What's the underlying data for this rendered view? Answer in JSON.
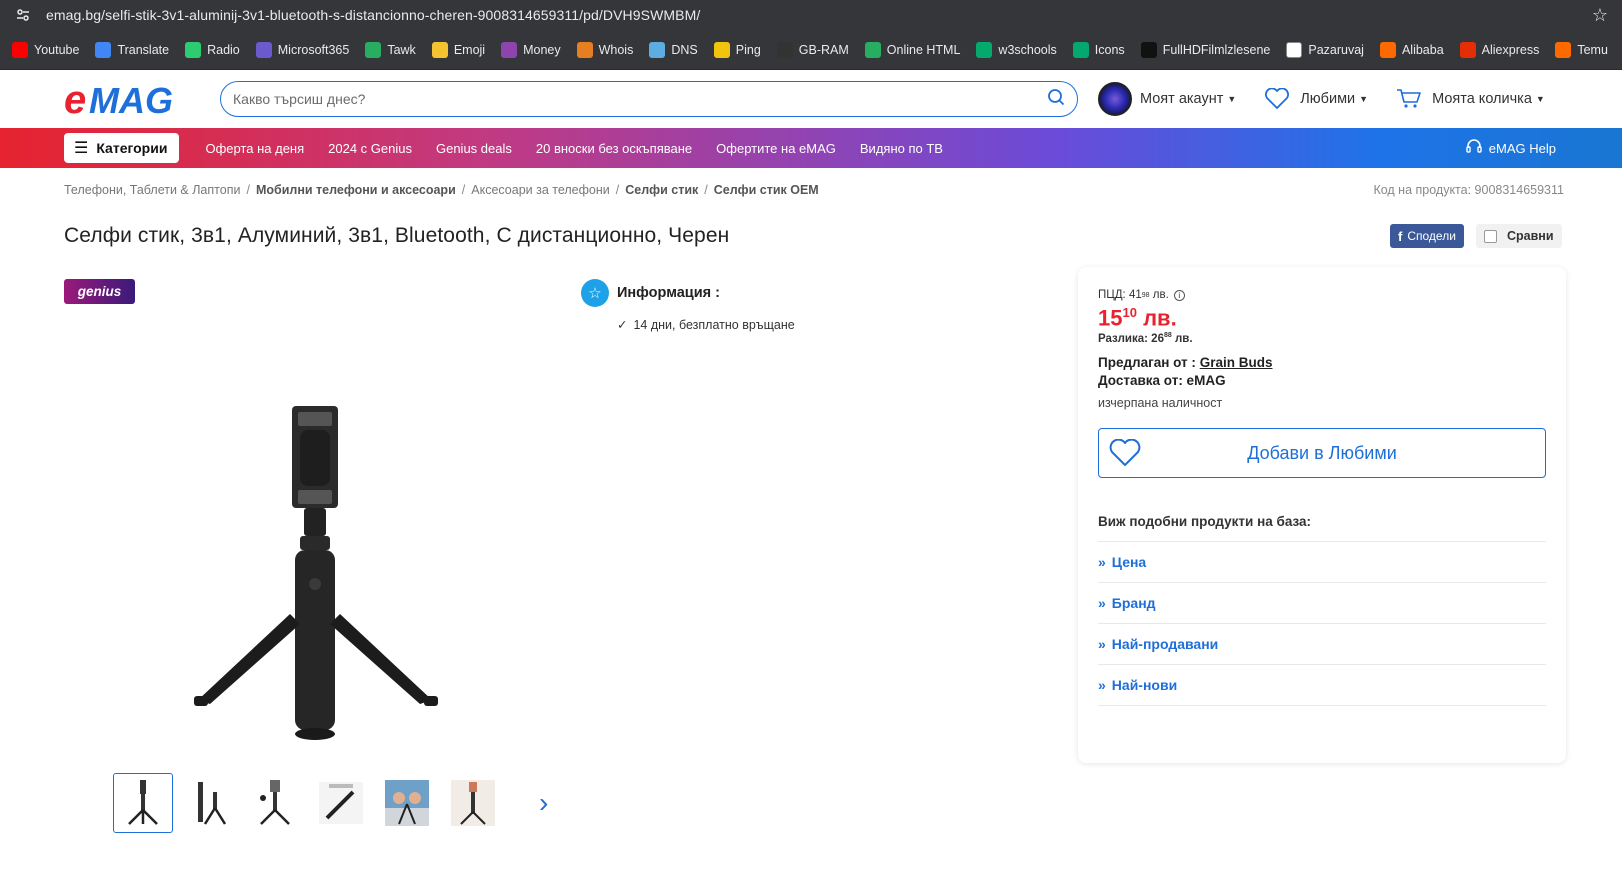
{
  "browser": {
    "url": "emag.bg/selfi-stik-3v1-aluminij-3v1-bluetooth-s-distancionno-cheren-9008314659311/pd/DVH9SWMBM/",
    "bookmarks": [
      {
        "label": "Youtube",
        "color": "#ff0000"
      },
      {
        "label": "Translate",
        "color": "#4285f4"
      },
      {
        "label": "Radio",
        "color": "#2ecc71"
      },
      {
        "label": "Microsoft365",
        "color": "#6a5acd"
      },
      {
        "label": "Tawk",
        "color": "#27ae60"
      },
      {
        "label": "Emoji",
        "color": "#f4c430"
      },
      {
        "label": "Money",
        "color": "#8e44ad"
      },
      {
        "label": "Whois",
        "color": "#e67e22"
      },
      {
        "label": "DNS",
        "color": "#5dade2"
      },
      {
        "label": "Ping",
        "color": "#f1c40f"
      },
      {
        "label": "GB-RAM",
        "color": "#333333"
      },
      {
        "label": "Online HTML",
        "color": "#27ae60"
      },
      {
        "label": "w3schools",
        "color": "#04aa6d"
      },
      {
        "label": "Icons",
        "color": "#04aa6d"
      },
      {
        "label": "FullHDFilmlzlesene",
        "color": "#111111"
      },
      {
        "label": "Pazaruvaj",
        "color": "#ffffff"
      },
      {
        "label": "Alibaba",
        "color": "#ff6a00"
      },
      {
        "label": "Aliexpress",
        "color": "#e62e04"
      },
      {
        "label": "Temu",
        "color": "#ff6a00"
      }
    ]
  },
  "header": {
    "logo": "eMAG",
    "search_placeholder": "Какво търсиш днес?",
    "account": "Моят акаунт",
    "favorites": "Любими",
    "cart": "Моята количка"
  },
  "nav": {
    "categories": "Категории",
    "links": [
      "Оферта на деня",
      "2024 с Genius",
      "Genius deals",
      "20 вноски без оскъпяване",
      "Офертите на eMAG",
      "Видяно по ТВ"
    ],
    "help": "eMAG Help"
  },
  "breadcrumb": [
    "Телефони, Таблети & Лаптопи",
    "Мобилни телефони и аксесоари",
    "Аксесоари за телефони",
    "Селфи стик",
    "Селфи стик OEM"
  ],
  "product": {
    "code": "Код на продукта: 9008314659311",
    "title": "Селфи стик, 3в1, Алуминий, 3в1, Bluetooth, С дистанционно, Черен",
    "share": "Сподели",
    "compare": "Сравни",
    "badge": "genius",
    "info_title": "Информация :",
    "info_return": "14 дни, безплатно връщане"
  },
  "pricing": {
    "pcd_label": "ПЦД: 41",
    "pcd_cents": "98",
    "pcd_currency": "лв.",
    "price_main": "15",
    "price_cents": "10",
    "price_currency": "лв.",
    "diff_label": "Разлика: 26",
    "diff_cents": "88",
    "diff_currency": "лв.",
    "seller_label": "Предлаган от :",
    "seller_name": "Grain Buds",
    "delivery": "Доставка от: eMAG",
    "stock": "изчерпана наличност",
    "fav_button": "Добави в Любими",
    "similar_title": "Виж подобни продукти на база:",
    "similar": [
      "Цена",
      "Бранд",
      "Най-продавани",
      "Най-нови"
    ]
  },
  "colors": {
    "brand_red": "#e8232f",
    "brand_blue": "#1e6fd9"
  }
}
